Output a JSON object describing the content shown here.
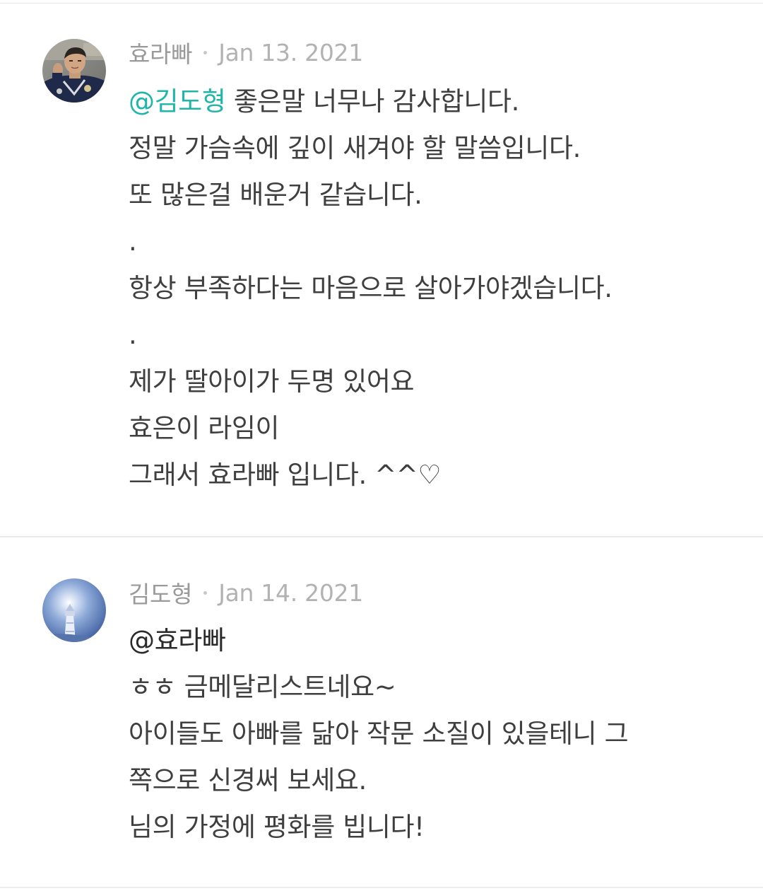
{
  "comments": [
    {
      "author": "효라빠",
      "date": "Jan 13. 2021",
      "mention": "@김도형",
      "first_line_rest": " 좋은말 너무나 감사합니다.",
      "lines": [
        "정말 가슴속에 깊이 새겨야 할 말씀입니다.",
        "또 많은걸 배운거 같습니다.",
        ".",
        "항상 부족하다는 마음으로 살아가야겠습니다.",
        ".",
        "제가 딸아이가 두명 있어요",
        "효은이 라임이",
        "그래서 효라빠 입니다. ^^♡"
      ],
      "avatar_icon": "profile-photo-man-in-uniform"
    },
    {
      "author": "김도형",
      "date": "Jan 14. 2021",
      "mention": "@효라빠",
      "lines": [
        "ㅎㅎ 금메달리스트네요~",
        "아이들도 아빠를 닮아 작문 소질이 있을테니 그",
        "쪽으로 신경써 보세요.",
        "님의 가정에 평화를 빕니다!"
      ],
      "avatar_icon": "profile-photo-lighthouse"
    }
  ],
  "colors": {
    "mention_accent": "#1fb5a9",
    "meta_text": "#a9a9a9",
    "body_text": "#3f3f3f",
    "divider": "#e9e9e9"
  }
}
